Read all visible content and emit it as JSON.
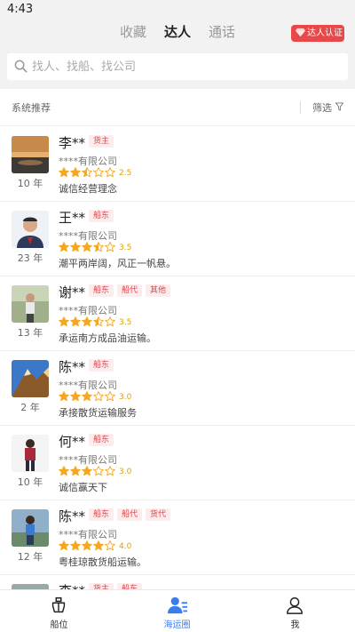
{
  "status_bar": {
    "time": "4:43"
  },
  "top_tabs": [
    {
      "label": "收藏",
      "active": false
    },
    {
      "label": "达人",
      "active": true
    },
    {
      "label": "通话",
      "active": false
    }
  ],
  "badge": {
    "label": "达人认证",
    "icon": "diamond-icon",
    "color": "#e8484a"
  },
  "search": {
    "placeholder": "找人、找船、找公司",
    "value": "",
    "icon": "search-icon"
  },
  "filter_bar": {
    "section_label": "系统推荐",
    "filter_label": "筛选",
    "filter_icon": "funnel-icon"
  },
  "tag_color": "#e0454a",
  "star_color": "#f5a623",
  "experts": [
    {
      "name": "李**",
      "tags": [
        "货主"
      ],
      "company": "****有限公司",
      "rating": 2.5,
      "rating_text": "2.5",
      "motto": "诚信经营理念",
      "years": "10 年",
      "avatar": "sunset-lake-photo"
    },
    {
      "name": "王**",
      "tags": [
        "船东"
      ],
      "company": "****有限公司",
      "rating": 3.5,
      "rating_text": "3.5",
      "motto": "潮平两岸阔，风正一帆悬。",
      "years": "23 年",
      "avatar": "man-portrait-photo"
    },
    {
      "name": "谢**",
      "tags": [
        "船东",
        "船代",
        "其他"
      ],
      "company": "****有限公司",
      "rating": 3.5,
      "rating_text": "3.5",
      "motto": "承运南方成品油运输。",
      "years": "13 年",
      "avatar": "man-outdoor-photo"
    },
    {
      "name": "陈**",
      "tags": [
        "船东"
      ],
      "company": "****有限公司",
      "rating": 3.0,
      "rating_text": "3.0",
      "motto": "承接散货运输服务",
      "years": "2 年",
      "avatar": "mountain-peak-photo"
    },
    {
      "name": "何**",
      "tags": [
        "船东"
      ],
      "company": "****有限公司",
      "rating": 3.0,
      "rating_text": "3.0",
      "motto": "诚信赢天下",
      "years": "10 年",
      "avatar": "woman-standing-photo"
    },
    {
      "name": "陈**",
      "tags": [
        "船东",
        "船代",
        "货代"
      ],
      "company": "****有限公司",
      "rating": 4.0,
      "rating_text": "4.0",
      "motto": "粤桂琼散货船运输。",
      "years": "12 年",
      "avatar": "woman-seaside-photo"
    },
    {
      "name": "李**",
      "tags": [
        "货主",
        "船东"
      ],
      "company": "",
      "rating": null,
      "rating_text": "",
      "motto": "",
      "years": "",
      "avatar": "partial-photo"
    }
  ],
  "bottom_nav": [
    {
      "label": "船位",
      "icon": "ship-icon",
      "active": false
    },
    {
      "label": "海运圈",
      "icon": "community-icon",
      "active": true
    },
    {
      "label": "我",
      "icon": "profile-icon",
      "active": false
    }
  ]
}
